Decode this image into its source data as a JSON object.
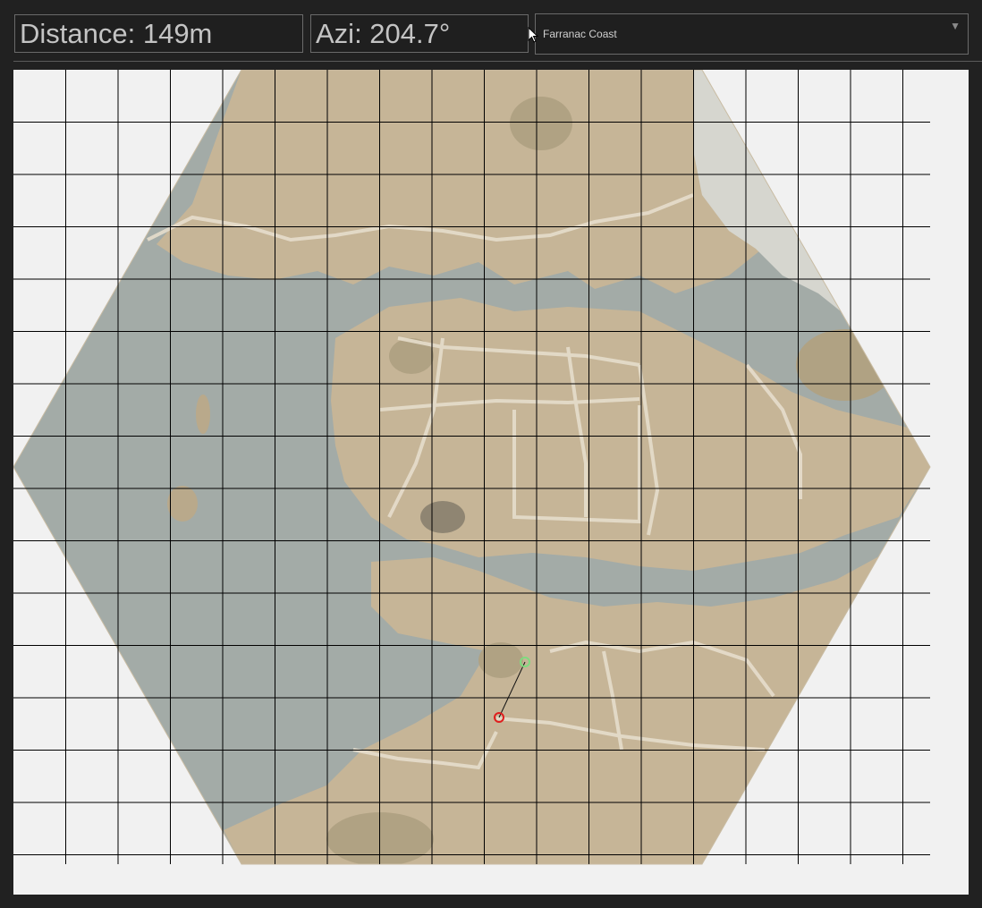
{
  "readouts": {
    "distance": "Distance: 149m",
    "azimuth": "Azi: 204.7°"
  },
  "map_selector": {
    "selected": "Farranac Coast",
    "caret_icon": "caret-down-icon"
  },
  "colors": {
    "background": "#212121",
    "field_border": "#6a6a6a",
    "readout_text": "#c4c4c4",
    "canvas": "#f1f1f1",
    "water": "#a3aba7",
    "land": "#c6b597",
    "land_dark": "#b0a283",
    "land_light": "#ddd0b4",
    "road": "#e6ddcc",
    "grid": "#000000",
    "marker_origin": "#e01e1e",
    "marker_target": "#7fdc7f"
  },
  "map": {
    "icons": [
      "mouse-pointer-icon",
      "origin-marker-icon",
      "target-marker-icon"
    ]
  }
}
